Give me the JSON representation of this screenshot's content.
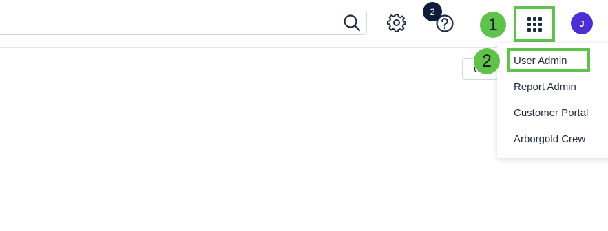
{
  "header": {
    "search": {
      "placeholder": "",
      "value": ""
    },
    "notification_count": "2",
    "avatar_initial": "J",
    "icons": {
      "search": "search-icon",
      "settings": "gear-icon",
      "help": "help-circle-icon",
      "apps": "app-grid-icon"
    }
  },
  "annotations": {
    "step_1": "1",
    "step_2": "2",
    "highlight_color": "#5fc24a"
  },
  "content": {
    "partial_button_label": "C"
  },
  "apps_menu": {
    "items": [
      {
        "label": "User Admin"
      },
      {
        "label": "Report Admin"
      },
      {
        "label": "Customer Portal"
      },
      {
        "label": "Arborgold Crew"
      }
    ]
  },
  "colors": {
    "avatar_bg": "#4b2fd3",
    "badge_bg": "#0e1b3d",
    "text": "#1f2a44"
  }
}
